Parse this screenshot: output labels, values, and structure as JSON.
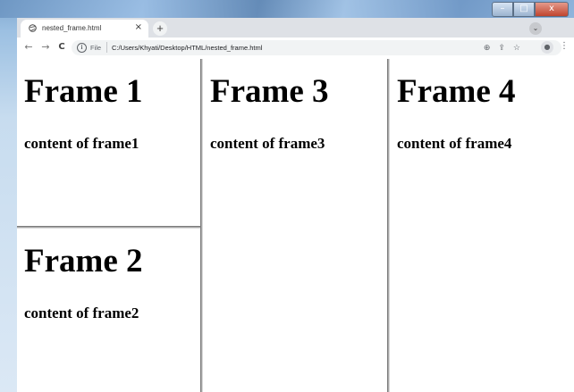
{
  "window": {
    "controls": {
      "minimize": "–",
      "maximize": "□",
      "close": "x"
    }
  },
  "tab": {
    "title": "nested_frame.html",
    "close": "×"
  },
  "newtab": "+",
  "tabsearch": "⌄",
  "toolbar": {
    "back": "←",
    "forward": "→",
    "reload": "C",
    "info": "i",
    "scheme": "File",
    "url": "C:/Users/Khyati/Desktop/HTML/nested_frame.html",
    "zoom_icon": "⊕",
    "share_icon": "⇪",
    "star_icon": "☆",
    "profile_icon": "●",
    "menu_icon": "⋮"
  },
  "frames": [
    {
      "title": "Frame 1",
      "content": "content of frame1"
    },
    {
      "title": "Frame 2",
      "content": "content of frame2"
    },
    {
      "title": "Frame 3",
      "content": "content of frame3"
    },
    {
      "title": "Frame 4",
      "content": "content of frame4"
    }
  ]
}
